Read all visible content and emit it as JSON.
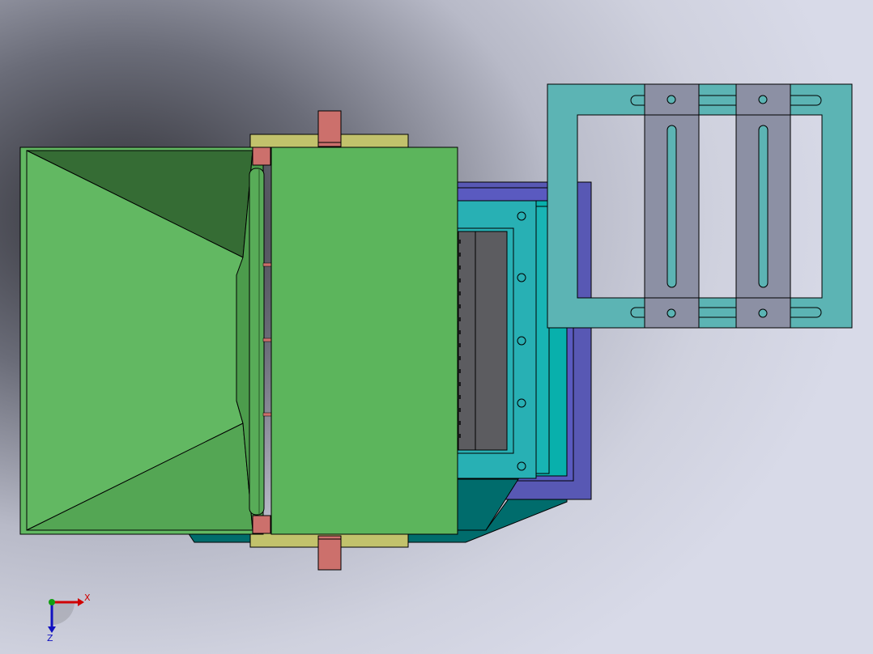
{
  "axes": {
    "x_label": "X",
    "z_label": "Z"
  },
  "colors": {
    "background_light": "#d8dae8",
    "background_dark": "#2e2e34",
    "hopper_light": "#62b862",
    "hopper_mid": "#54a654",
    "hopper_dark": "#356c34",
    "body_green": "#5cb55c",
    "yellow_plate": "#c2c26c",
    "pin_copper": "#cc706c",
    "frame_teal": "#5cb4b4",
    "slot_bar_gray": "#8c90a4",
    "plate_purple": "#5858b4",
    "plate_cyan": "#08b0ac",
    "plate_teal_light": "#28b0b4",
    "base_dark_teal": "#006c6c",
    "grate_dark": "#5c5c60",
    "axis_x_red": "#d00000",
    "axis_z_blue": "#1010c0",
    "axis_y_green": "#10a010"
  }
}
